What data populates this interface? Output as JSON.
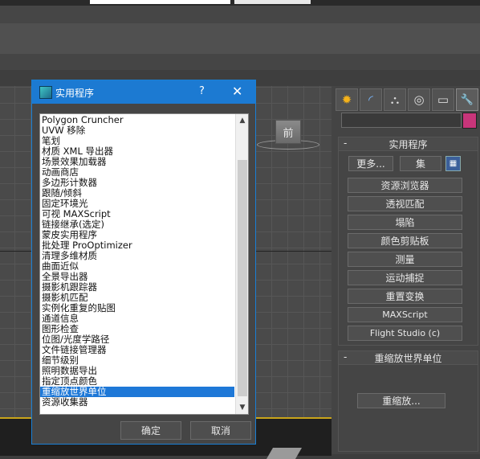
{
  "viewport": {
    "viewcube_label": "前"
  },
  "command_panel": {
    "tabs": [
      {
        "icon": "create-icon",
        "glyph": "✹"
      },
      {
        "icon": "modify-icon",
        "glyph": "◜"
      },
      {
        "icon": "hierarchy-icon",
        "glyph": "⛬"
      },
      {
        "icon": "motion-icon",
        "glyph": "◎"
      },
      {
        "icon": "display-icon",
        "glyph": "▭"
      },
      {
        "icon": "utilities-icon",
        "glyph": "🔧"
      }
    ],
    "color_swatch": "#c8357a",
    "utilities_rollout": {
      "minus": "-",
      "title": "实用程序",
      "more_label": "更多...",
      "sets_label": "集",
      "buttons": [
        "资源浏览器",
        "透视匹配",
        "塌陷",
        "颜色剪贴板",
        "测量",
        "运动捕捉",
        "重置变换",
        "MAXScript",
        "Flight Studio (c)"
      ]
    },
    "rescale_rollout": {
      "minus": "-",
      "title": "重缩放世界单位",
      "button_label": "重缩放..."
    }
  },
  "dialog": {
    "title": "实用程序",
    "help": "?",
    "close": "✕",
    "items": [
      "Polygon Cruncher",
      "UVW 移除",
      "笔划",
      "材质 XML 导出器",
      "场景效果加载器",
      "动画商店",
      "多边形计数器",
      "跟随/倾斜",
      "固定环境光",
      "可视 MAXScript",
      "链接继承(选定)",
      "蒙皮实用程序",
      "批处理 ProOptimizer",
      "清理多维材质",
      "曲面近似",
      "全景导出器",
      "摄影机跟踪器",
      "摄影机匹配",
      "实例化重复的贴图",
      "通道信息",
      "图形检查",
      "位图/光度学路径",
      "文件链接管理器",
      "细节级别",
      "照明数据导出",
      "指定顶点颜色",
      "重缩放世界单位",
      "资源收集器"
    ],
    "selected_index": 26,
    "ok_label": "确定",
    "cancel_label": "取消"
  }
}
